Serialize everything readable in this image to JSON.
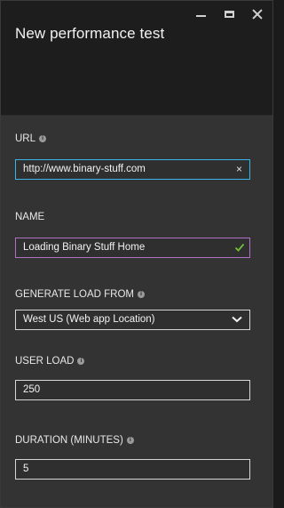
{
  "window": {
    "title": "New performance test",
    "controls": [
      "minimize-icon",
      "maximize-icon",
      "close-icon"
    ]
  },
  "form": {
    "url": {
      "label": "URL",
      "value": "http://www.binary-stuff.com",
      "clear_icon": "×"
    },
    "name": {
      "label": "NAME",
      "value": "Loading Binary Stuff Home",
      "valid_icon": "check-icon"
    },
    "generate_load_from": {
      "label": "GENERATE LOAD FROM",
      "selected": "West US (Web app Location)"
    },
    "user_load": {
      "label": "USER LOAD",
      "value": "250"
    },
    "duration": {
      "label": "DURATION (MINUTES)",
      "value": "5"
    }
  },
  "colors": {
    "focus_border": "#3bb4e8",
    "valid_border": "#b070c6",
    "valid_check": "#6fbf3a",
    "panel_bg": "#333333",
    "header_bg": "#1d1d1d"
  }
}
